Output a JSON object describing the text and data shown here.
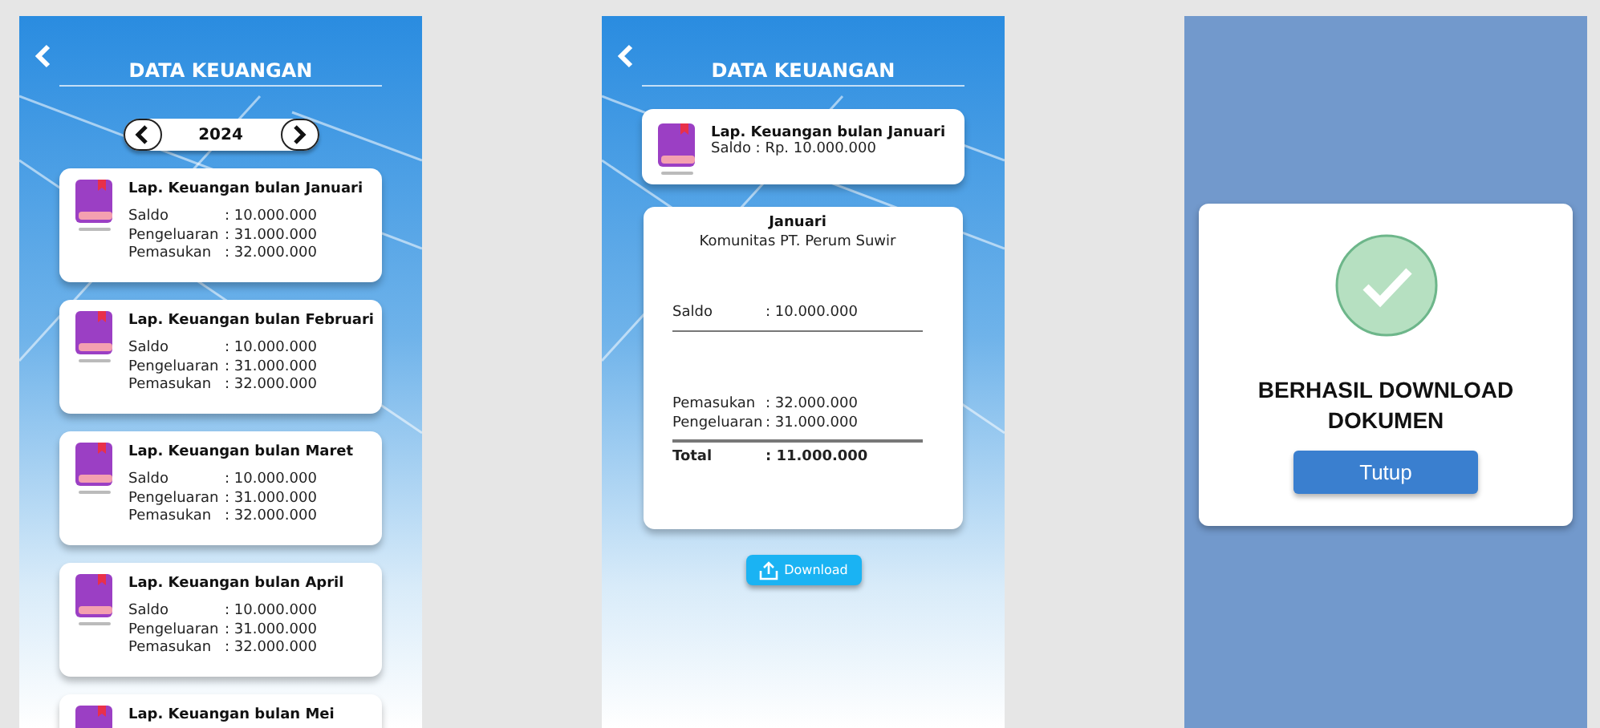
{
  "list_screen": {
    "title": "DATA KEUANGAN",
    "year": "2024",
    "reports": [
      {
        "title": "Lap. Keuangan bulan Januari",
        "rows": [
          {
            "label": "Saldo",
            "value": ": 10.000.000"
          },
          {
            "label": "Pengeluaran",
            "value": ": 31.000.000"
          },
          {
            "label": "Pemasukan",
            "value": ": 32.000.000"
          }
        ]
      },
      {
        "title": "Lap. Keuangan bulan Februari",
        "rows": [
          {
            "label": "Saldo",
            "value": ": 10.000.000"
          },
          {
            "label": "Pengeluaran",
            "value": ": 31.000.000"
          },
          {
            "label": "Pemasukan",
            "value": ": 32.000.000"
          }
        ]
      },
      {
        "title": "Lap. Keuangan bulan Maret",
        "rows": [
          {
            "label": "Saldo",
            "value": ": 10.000.000"
          },
          {
            "label": "Pengeluaran",
            "value": ": 31.000.000"
          },
          {
            "label": "Pemasukan",
            "value": ": 32.000.000"
          }
        ]
      },
      {
        "title": "Lap. Keuangan bulan April",
        "rows": [
          {
            "label": "Saldo",
            "value": ": 10.000.000"
          },
          {
            "label": "Pengeluaran",
            "value": ": 31.000.000"
          },
          {
            "label": "Pemasukan",
            "value": ": 32.000.000"
          }
        ]
      },
      {
        "title": "Lap. Keuangan bulan Mei"
      }
    ]
  },
  "detail_screen": {
    "title": "DATA KEUANGAN",
    "summary_title": "Lap. Keuangan bulan Januari",
    "summary_balance": "Saldo : Rp. 10.000.000",
    "month": "Januari",
    "organization": "Komunitas PT. Perum Suwir",
    "balance": {
      "label": "Saldo",
      "value": ": 10.000.000"
    },
    "flows": [
      {
        "label": "Pemasukan",
        "value": ": 32.000.000"
      },
      {
        "label": "Pengeluaran",
        "value": ": 31.000.000"
      }
    ],
    "total": {
      "label": "Total",
      "value": ": 11.000.000"
    },
    "download_button": "Download"
  },
  "success_dialog": {
    "message": "BERHASIL DOWNLOAD DOKUMEN",
    "button": "Tutup"
  }
}
